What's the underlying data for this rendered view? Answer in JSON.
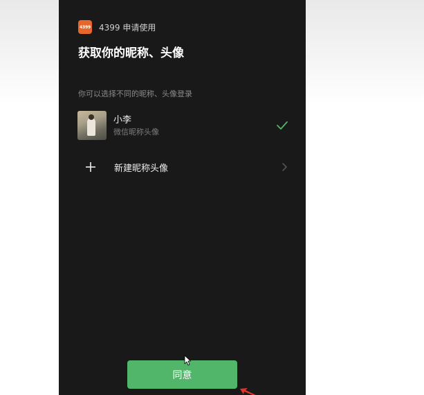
{
  "header": {
    "app_logo_text": "4399",
    "request_text": "4399 申请使用",
    "title": "获取你的昵称、头像"
  },
  "subtitle": "你可以选择不同的昵称、头像登录",
  "accounts": [
    {
      "name": "小李",
      "source": "微信昵称头像",
      "selected": true
    }
  ],
  "new_profile": {
    "label": "新建昵称头像"
  },
  "agree_button": {
    "label": "同意"
  },
  "colors": {
    "phone_background": "#191919",
    "accent_green": "#52b66a",
    "logo_orange": "#e7662b",
    "annotation_red": "#e0342d"
  },
  "icons": [
    "app-logo",
    "check-icon",
    "plus-icon",
    "chevron-right-icon",
    "mouse-cursor-icon",
    "red-arrow-icon"
  ]
}
